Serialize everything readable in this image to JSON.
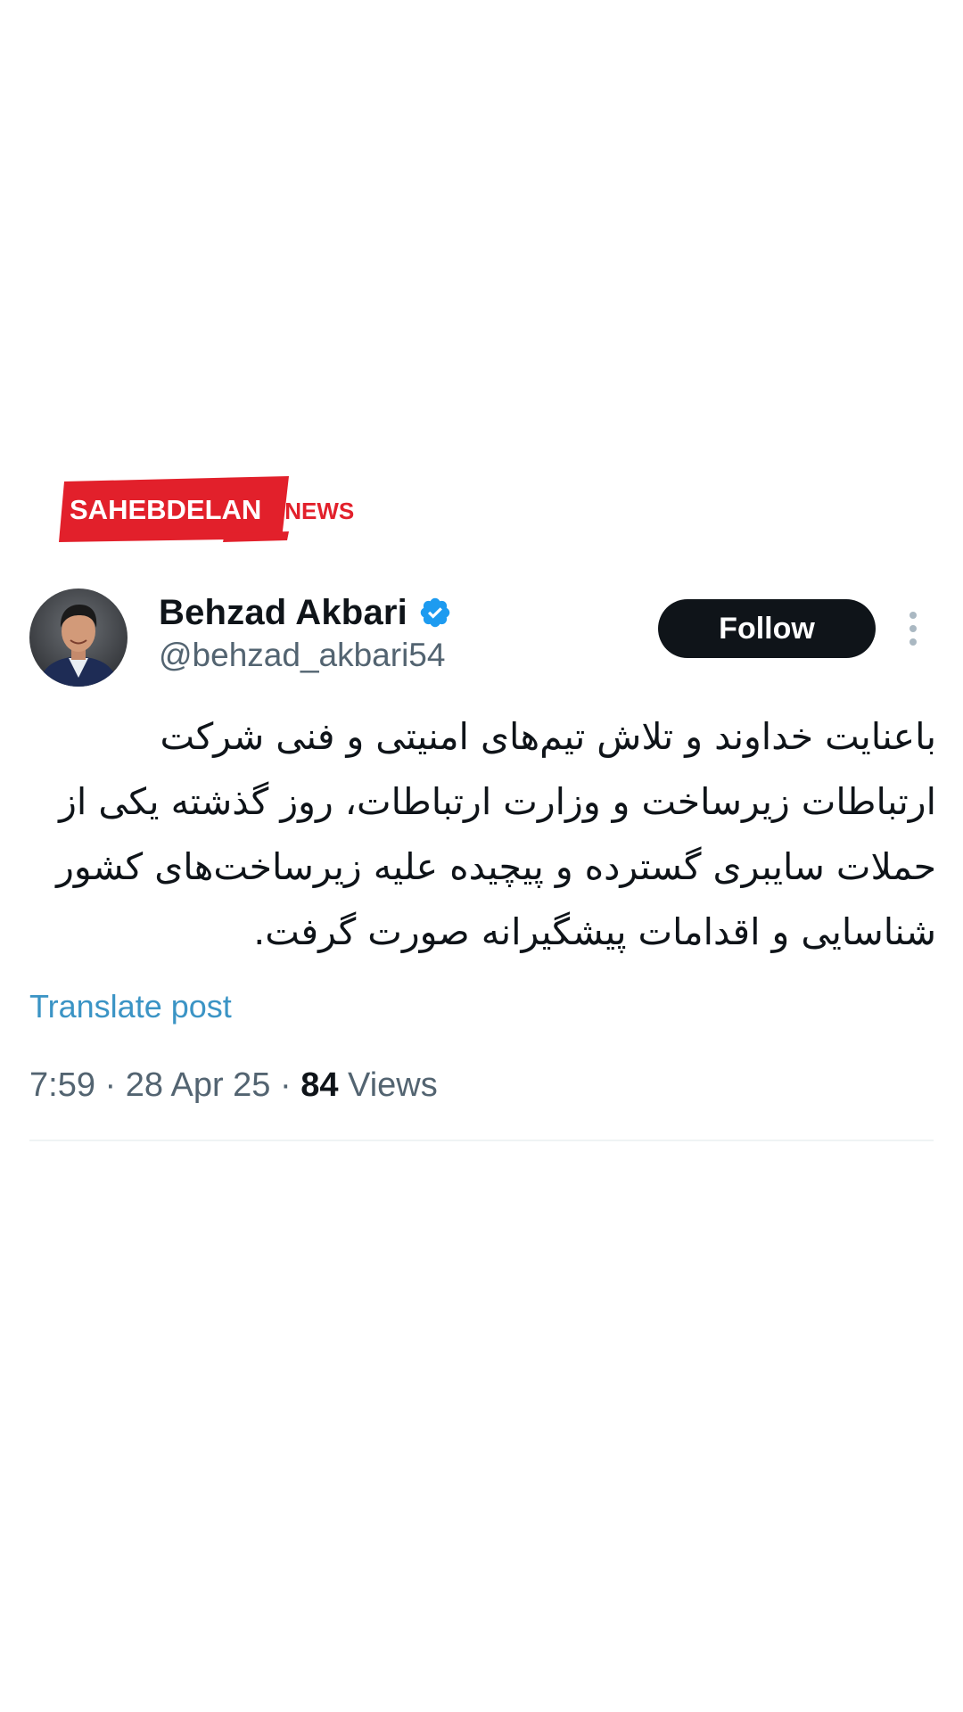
{
  "watermark": {
    "brand": "SAHEBDELAN",
    "suffix": ".NEWS",
    "colors": {
      "red": "#e2202b",
      "white": "#ffffff"
    }
  },
  "tweet": {
    "author": {
      "display_name": "Behzad Akbari",
      "handle": "@behzad_akbari54",
      "verified_icon": "verified-badge-icon",
      "avatar_icon": "profile-photo"
    },
    "follow_label": "Follow",
    "more_icon": "more-vertical-icon",
    "text": "باعنایت خداوند و تلاش تیم‌های امنیتی و فنی شرکت ارتباطات زیرساخت و وزارت ارتباطات، روز گذشته یکی از حملات سایبری گسترده و پیچیده علیه زیرساخت‌های کشور شناسایی و اقدامات پیشگیرانه صورت گرفت.",
    "translate_label": "Translate post",
    "time": "7:59",
    "sep1": " · ",
    "date": "28 Apr 25",
    "sep2": " · ",
    "views_count": "84",
    "views_label": " Views"
  },
  "colors": {
    "text_primary": "#0f1419",
    "text_secondary": "#536471",
    "link": "#3b94c5",
    "verified": "#1d9bf0",
    "button_bg": "#0f1419"
  }
}
